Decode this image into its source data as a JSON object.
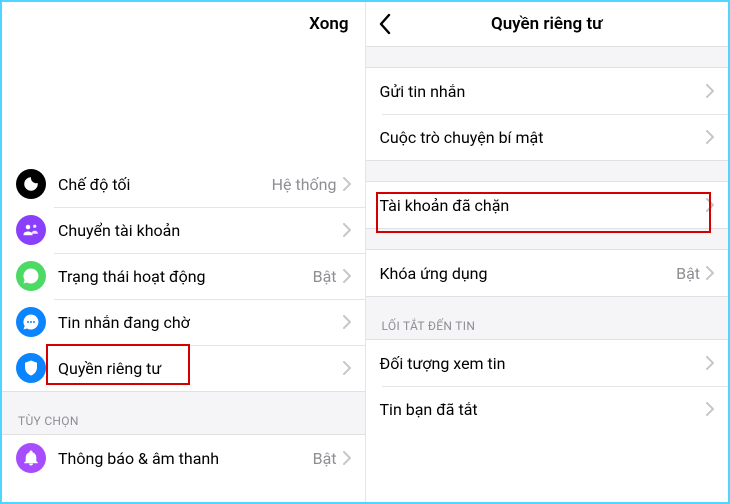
{
  "left": {
    "done": "Xong",
    "rows": {
      "dark_mode": {
        "label": "Chế độ tối",
        "value": "Hệ thống"
      },
      "switch_account": {
        "label": "Chuyển tài khoản"
      },
      "active_status": {
        "label": "Trạng thái hoạt động",
        "value": "Bật"
      },
      "message_requests": {
        "label": "Tin nhắn đang chờ"
      },
      "privacy": {
        "label": "Quyền riêng tư"
      }
    },
    "section_options": "TÙY CHỌN",
    "rows2": {
      "notifications": {
        "label": "Thông báo & âm thanh",
        "value": "Bật"
      }
    }
  },
  "right": {
    "title": "Quyền riêng tư",
    "rows": {
      "send_msg": {
        "label": "Gửi tin nhắn"
      },
      "secret_conv": {
        "label": "Cuộc trò chuyện bí mật"
      },
      "blocked": {
        "label": "Tài khoản đã chặn"
      },
      "app_lock": {
        "label": "Khóa ứng dụng",
        "value": "Bật"
      }
    },
    "section_story": "LỐI TẮT ĐẾN TIN",
    "rows2": {
      "story_audience": {
        "label": "Đối tượng xem tin"
      },
      "muted_stories": {
        "label": "Tin bạn đã tắt"
      }
    }
  }
}
